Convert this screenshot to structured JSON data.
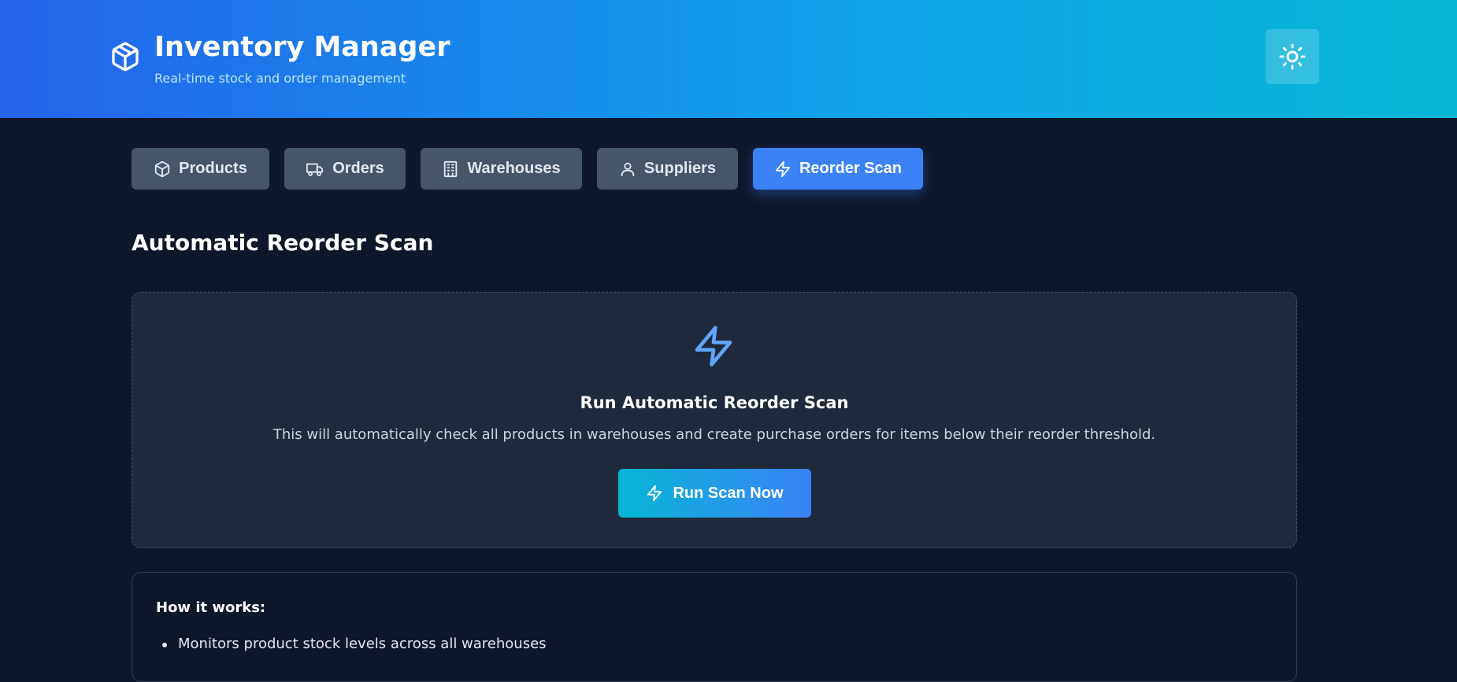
{
  "header": {
    "title": "Inventory Manager",
    "subtitle": "Real-time stock and order management",
    "brand_icon": "package-icon",
    "theme_toggle_icon": "sun-icon"
  },
  "tabs": [
    {
      "label": "Products",
      "icon": "package-icon",
      "active": false
    },
    {
      "label": "Orders",
      "icon": "truck-icon",
      "active": false
    },
    {
      "label": "Warehouses",
      "icon": "building-icon",
      "active": false
    },
    {
      "label": "Suppliers",
      "icon": "user-icon",
      "active": false
    },
    {
      "label": "Reorder Scan",
      "icon": "lightning-icon",
      "active": true
    }
  ],
  "main": {
    "title": "Automatic Reorder Scan",
    "scan_card": {
      "icon": "lightning-icon",
      "heading": "Run Automatic Reorder Scan",
      "description": "This will automatically check all products in warehouses and create purchase orders for items below their reorder threshold.",
      "button_label": "Run Scan Now"
    },
    "how_it_works": {
      "title": "How it works:",
      "items": [
        "Monitors product stock levels across all warehouses"
      ]
    }
  },
  "colors": {
    "background": "#0f172a",
    "card": "#1e293b",
    "accent": "#3b82f6",
    "tab_inactive": "#475569",
    "gradient_start": "#2563eb",
    "gradient_end": "#06b6d4"
  }
}
